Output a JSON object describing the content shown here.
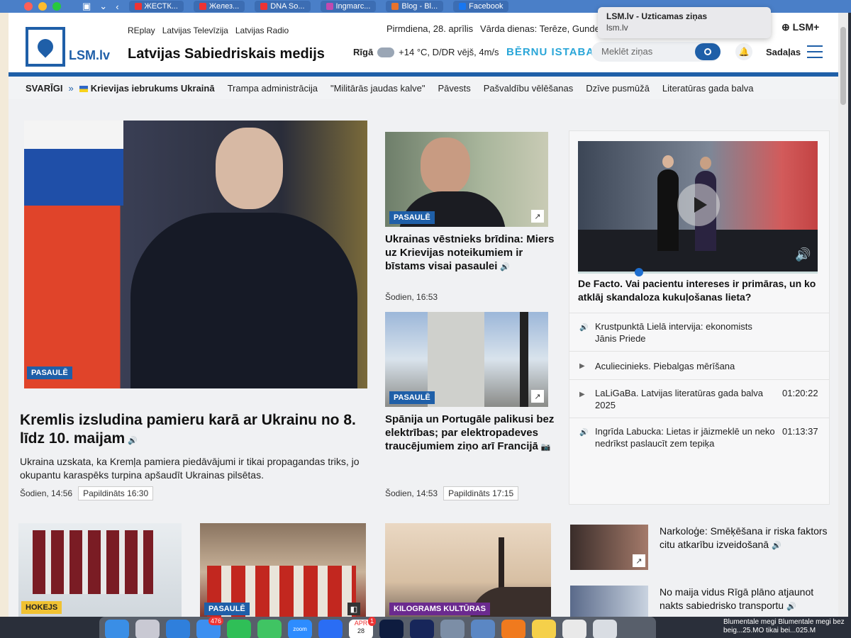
{
  "browser": {
    "tabs": [
      {
        "label": "ЖЕСТК..."
      },
      {
        "label": "Желез..."
      },
      {
        "label": "DNA So..."
      },
      {
        "label": "Ingmarc..."
      },
      {
        "label": "Blog - Bl..."
      },
      {
        "label": "Facebook"
      }
    ],
    "tooltip": {
      "title": "LSM.lv - Uzticamas ziņas",
      "url": "lsm.lv"
    }
  },
  "header": {
    "logo_text": "LSM.lv",
    "site_title": "Latvijas Sabiedriskais medijs",
    "top_links": [
      "REplay",
      "Latvijas Televīzija",
      "Latvijas Radio"
    ],
    "date": "Pirmdiena, 28. aprīlis",
    "name_days": "Vārda dienas: Terēze, Gunde",
    "lsm_plus": "LSM+",
    "weather": {
      "city": "Rīgā",
      "text": "+14 °C, D/DR vējš, 4m/s"
    },
    "bernu_istaba": "BĒRNU ISTABA",
    "search_placeholder": "Meklēt ziņas",
    "sections_label": "Sadaļas"
  },
  "nav": {
    "important": "SVARĪGI",
    "items": [
      "Krievijas iebrukums Ukrainā",
      "Trampa administrācija",
      "\"Militārās jaudas kalve\"",
      "Pāvests",
      "Pašvaldību vēlēšanas",
      "Dzīve pusmūžā",
      "Literatūras gada balva"
    ]
  },
  "main_story": {
    "tag": "PASAULĒ",
    "headline": "Kremlis izsludina pamieru karā ar Ukrainu no 8. līdz 10. maijam",
    "lead": "Ukraina uzskata, ka Kremļa pamiera piedāvājumi ir tikai propagandas triks, jo okupantu karaspēks turpina apšaudīt Ukrainas pilsētas.",
    "time": "Šodien, 14:56",
    "updated": "Papildināts 16:30"
  },
  "story2": {
    "tag": "PASAULĒ",
    "headline": "Ukrainas vēstnieks brīdina: Miers uz Krievijas noteikumiem ir bīstams visai pasaulei",
    "time": "Šodien, 16:53"
  },
  "story3": {
    "tag": "PASAULĒ",
    "headline": "Spānija un Portugāle palikusi bez elektrības; par elektropadeves traucējumiem ziņo arī Francijā",
    "time": "Šodien, 14:53",
    "updated": "Papildināts 17:15"
  },
  "video_box": {
    "title": "De Facto. Vai pacientu intereses ir primāras, un ko atklāj skandaloza kukuļošanas lieta?",
    "items": [
      {
        "text": "Krustpunktā Lielā intervija: ekonomists Jānis Priede",
        "time": ""
      },
      {
        "text": "Aculiecinieks. Piebalgas mērīšana",
        "time": ""
      },
      {
        "text": "LaLiGaBa. Latvijas literatūras gada balva 2025",
        "time": "01:20:22"
      },
      {
        "text": "Ingrīda Labucka: Lietas ir jāizmeklē un neko nedrīkst paslaucīt zem tepiķa",
        "time": "01:13:37"
      }
    ]
  },
  "bottom": {
    "tags": [
      "HOKEJS",
      "PASAULĒ",
      "KILOGRAMS KULTŪRAS"
    ],
    "side_items": [
      "Narkoloģe: Smēķēšana ir riska faktors citu atkarību izveidošanā",
      "No maija vidus Rīgā plāno atjaunot nakts sabiedrisko transportu"
    ]
  },
  "dock": {
    "mail_badge": "476",
    "cal_month": "APR",
    "cal_day": "28",
    "cal_badge": "1",
    "zoom_label": "zoom",
    "notification": "Blumentale megi Blumentale megi bez beig...25.MO tikai bei...025.M"
  }
}
